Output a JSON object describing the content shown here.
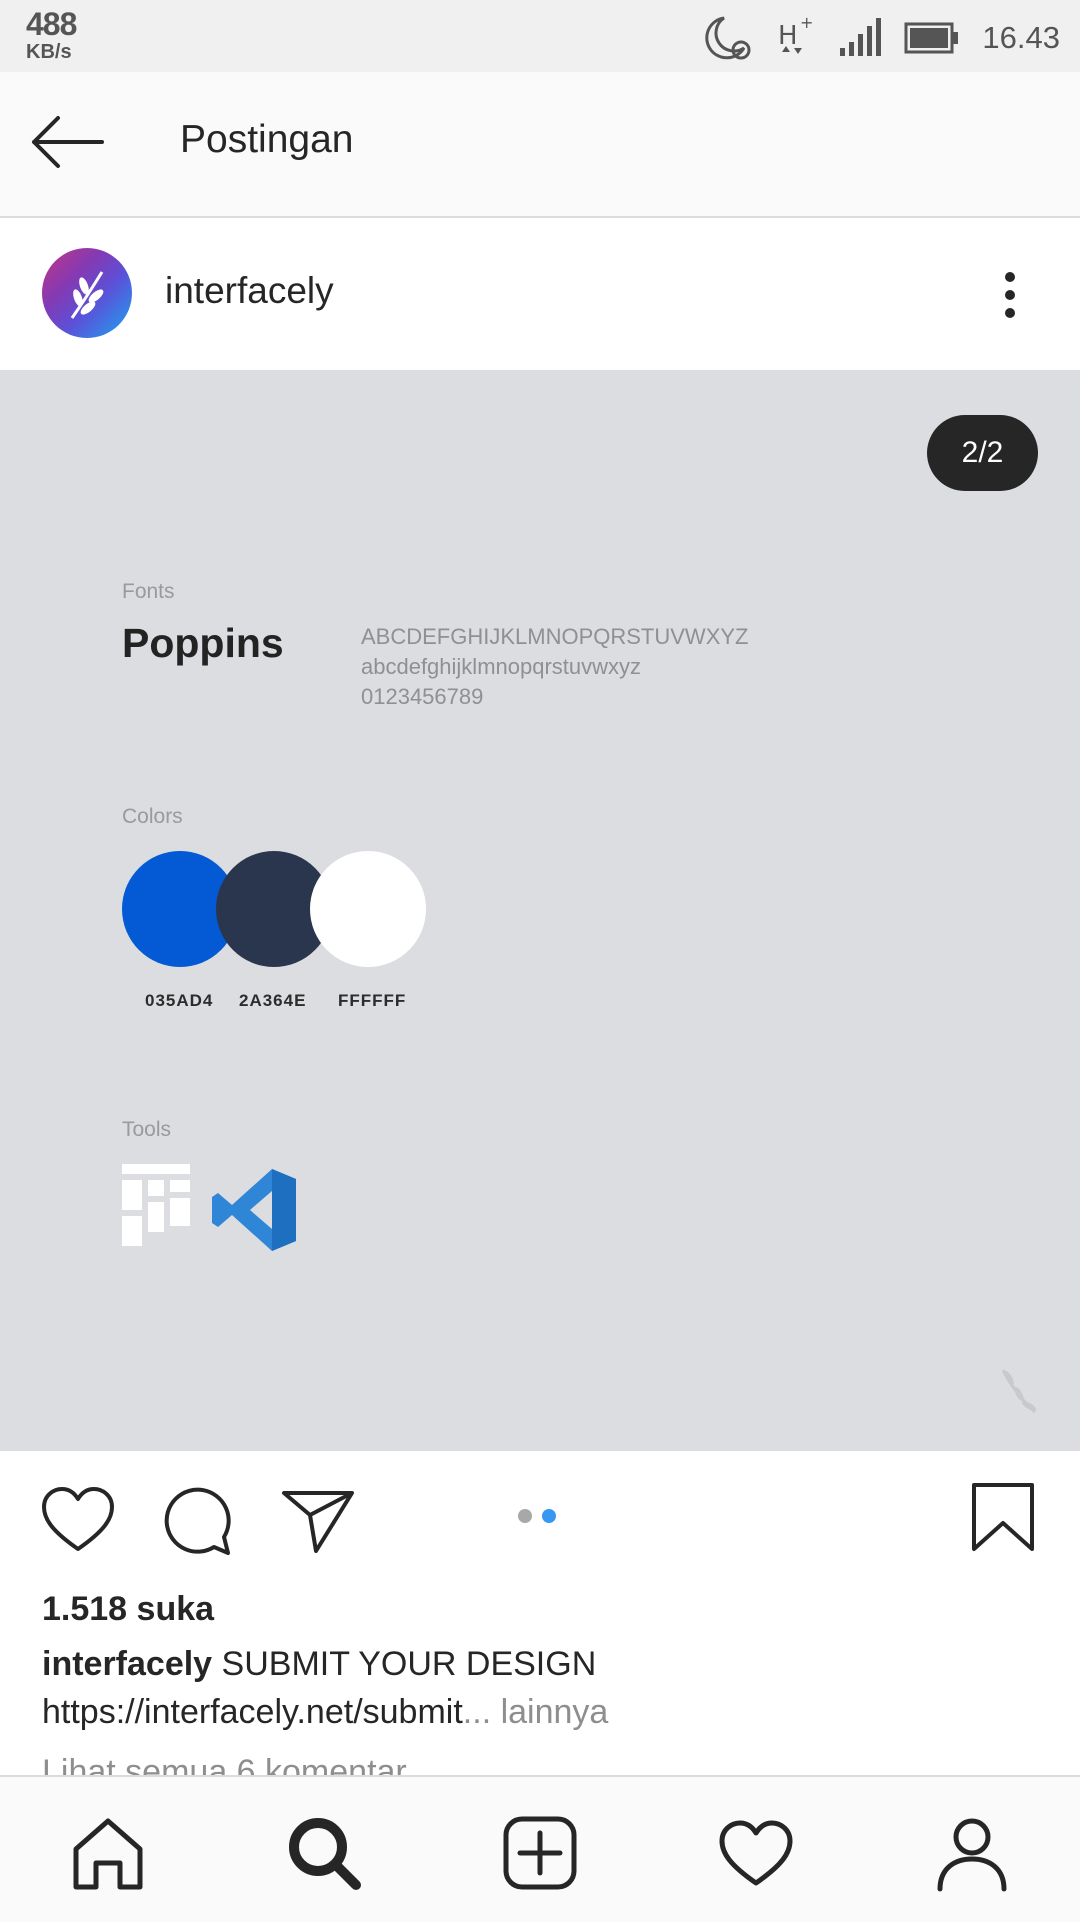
{
  "status_bar": {
    "speed_value": "488",
    "speed_unit": "KB/s",
    "time": "16.43",
    "network": "H+",
    "icons": [
      "moon-icon",
      "alarm-icon",
      "network-h-plus-icon",
      "signal-icon",
      "battery-icon"
    ]
  },
  "header": {
    "title": "Postingan",
    "back_icon": "arrow-left-icon"
  },
  "post": {
    "username": "interfacely",
    "more_icon": "more-vertical-icon",
    "image_counter": "2/2",
    "image": {
      "fonts_label": "Fonts",
      "font_name": "Poppins",
      "font_sample_upper": "ABCDEFGHIJKLMNOPQRSTUVWXYZ",
      "font_sample_lower": "abcdefghijklmnopqrstuvwxyz",
      "font_sample_digits": "0123456789",
      "colors_label": "Colors",
      "colors": [
        {
          "hex": "#035AD4",
          "label": "035AD4"
        },
        {
          "hex": "#2A364E",
          "label": "2A364E"
        },
        {
          "hex": "#FFFFFF",
          "label": "FFFFFF"
        }
      ],
      "tools_label": "Tools",
      "tools": [
        "grid-tool-icon",
        "vscode-icon"
      ]
    },
    "carousel": {
      "total": 2,
      "active": 2,
      "active_color": "#3897f0",
      "inactive_color": "#a8a8a8"
    },
    "likes": "1.518 suka",
    "caption_user": "interfacely",
    "caption_text": "SUBMIT YOUR DESIGN",
    "caption_link": "https://interfacely.net/submit",
    "more_link": "... lainnya",
    "view_comments": "Lihat semua 6 komentar"
  },
  "bottom_nav": [
    "home-icon",
    "search-icon",
    "add-post-icon",
    "activity-heart-icon",
    "profile-icon"
  ]
}
